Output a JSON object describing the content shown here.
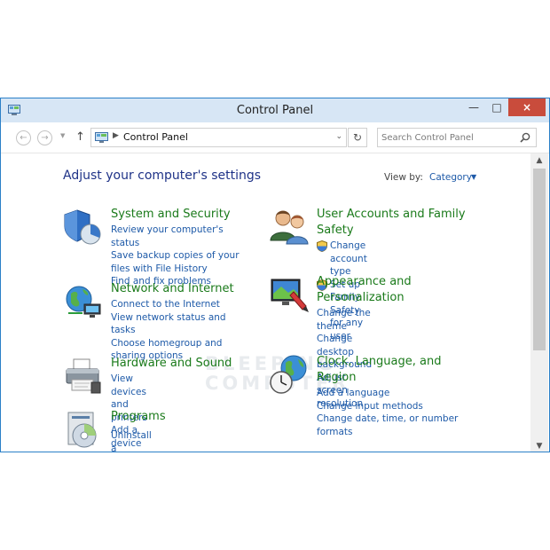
{
  "window": {
    "title": "Control Panel"
  },
  "titlebar": {
    "minimize": "—",
    "maximize": "□",
    "close": "×"
  },
  "address": {
    "back": "←",
    "forward": "→",
    "dropdown": "▼",
    "up": "↑",
    "crumb_sep": "▶",
    "crumb": "Control Panel",
    "addr_dropdown": "⌄",
    "refresh": "↻",
    "search_placeholder": "Search Control Panel"
  },
  "header": {
    "title": "Adjust your computer's settings",
    "view_by_label": "View by:",
    "view_by_value": "Category",
    "view_by_arrow": "▼"
  },
  "categories": [
    {
      "icon": "shield-icon",
      "title": "System and Security",
      "links": [
        "Review your computer's status",
        "Save backup copies of your files with File History",
        "Find and fix problems"
      ]
    },
    {
      "icon": "network-icon",
      "title": "Network and Internet",
      "links": [
        "Connect to the Internet",
        "View network status and tasks",
        "Choose homegroup and sharing options"
      ]
    },
    {
      "icon": "printer-icon",
      "title": "Hardware and Sound",
      "links": [
        "View devices and printers",
        "Add a device"
      ]
    },
    {
      "icon": "programs-icon",
      "title": "Programs",
      "links": [
        "Uninstall a program"
      ]
    },
    {
      "icon": "users-icon",
      "title": "User Accounts and Family Safety",
      "links": [
        "Change account type",
        "Set up Family Safety for any user"
      ]
    },
    {
      "icon": "appearance-icon",
      "title": "Appearance and Personalization",
      "links": [
        "Change the theme",
        "Change desktop background",
        "Adjust screen resolution"
      ]
    },
    {
      "icon": "clock-globe-icon",
      "title": "Clock, Language, and Region",
      "links": [
        "Add a language",
        "Change input methods",
        "Change date, time, or number formats"
      ]
    }
  ],
  "watermark": {
    "line1": "BLEEPING",
    "line2": "COMPUTER"
  },
  "scrollbar": {
    "up": "▲",
    "down": "▼",
    "position": 0.0
  },
  "colors": {
    "title_bar": "#d7e6f5",
    "accent_border": "#2b80c8",
    "category_title": "#1a7a1a",
    "link": "#1e5aa8",
    "heading": "#1e3287",
    "close": "#c94c3c"
  }
}
